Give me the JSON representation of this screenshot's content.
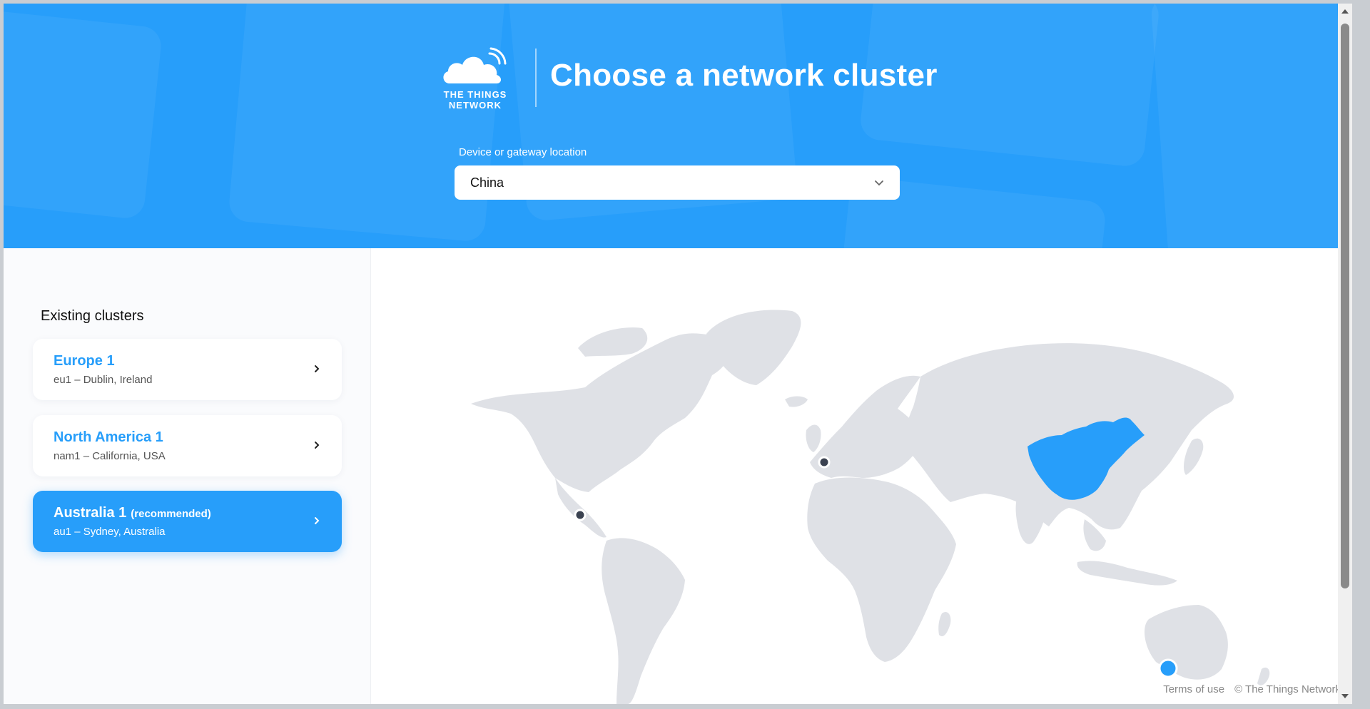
{
  "header": {
    "logo_line1": "THE THINGS",
    "logo_line2": "NETWORK",
    "title": "Choose a network cluster",
    "location_label": "Device or gateway location",
    "location_value": "China"
  },
  "sidebar": {
    "title": "Existing clusters",
    "clusters": [
      {
        "name": "Europe 1",
        "badge": "",
        "subtitle": "eu1 – Dublin, Ireland",
        "selected": false
      },
      {
        "name": "North America 1",
        "badge": "",
        "subtitle": "nam1 – California, USA",
        "selected": false
      },
      {
        "name": "Australia 1",
        "badge": "(recommended)",
        "subtitle": "au1 – Sydney, Australia",
        "selected": true
      }
    ]
  },
  "map": {
    "highlighted_country": "China",
    "colors": {
      "land": "#dfe1e6",
      "highlight": "#279efa",
      "cluster_dot": "#3a4150",
      "active_dot": "#279efa"
    }
  },
  "footer": {
    "terms_label": "Terms of use",
    "copyright": "© The Things Network"
  },
  "colors": {
    "brand": "#279efa",
    "text": "#111111"
  }
}
